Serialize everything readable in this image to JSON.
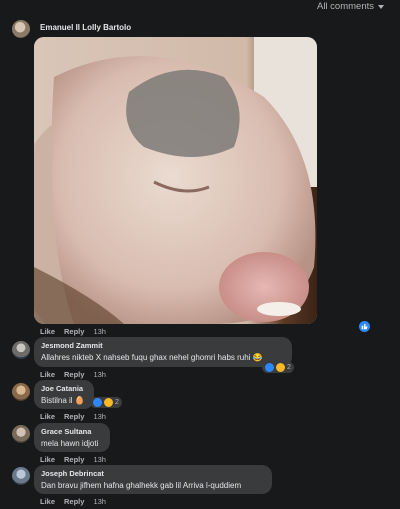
{
  "header": {
    "all_comments_label": "All comments"
  },
  "post": {
    "author": "Emanuel Il Lolly Bartolo",
    "actions": {
      "like": "Like",
      "reply": "Reply",
      "time": "13h"
    },
    "reactions_icon": "like-icon"
  },
  "comments": [
    {
      "author": "Jesmond Zammit",
      "text": "Allahres nikteb X nahseb fuqu ghax nehel ghomri habs ruhi",
      "emoji": "😂",
      "like": "Like",
      "reply": "Reply",
      "time": "13h",
      "reactions": {
        "icons": [
          "like-icon",
          "haha-icon"
        ],
        "count": "2"
      }
    },
    {
      "author": "Joe Catania",
      "text": "Bistilna il",
      "emoji": "🥚",
      "like": "Like",
      "reply": "Reply",
      "time": "13h",
      "reactions": {
        "icons": [
          "like-icon",
          "haha-icon"
        ],
        "count": "2"
      }
    },
    {
      "author": "Grace Sultana",
      "text": "mela hawn idjoti",
      "like": "Like",
      "reply": "Reply",
      "time": "13h"
    },
    {
      "author": "Joseph Debrincat",
      "text": "Dan bravu jifhem hafna ghalhekk gab lil Arriva l-quddiem",
      "like": "Like",
      "reply": "Reply",
      "time": "13h"
    }
  ],
  "colors": {
    "background": "#18191a",
    "bubble": "#3a3b3c",
    "text": "#e4e6eb",
    "muted": "#b0b3b8",
    "like_blue": "#2d88ff",
    "haha_yellow": "#f7b928"
  }
}
